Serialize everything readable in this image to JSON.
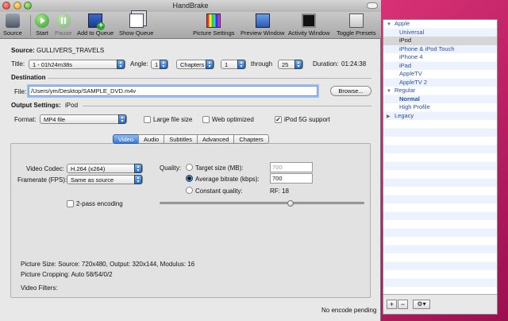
{
  "window": {
    "title": "HandBrake"
  },
  "toolbar": {
    "source": "Source",
    "start": "Start",
    "pause": "Pause",
    "add_to_queue": "Add to Queue",
    "show_queue": "Show Queue",
    "picture_settings": "Picture Settings",
    "preview_window": "Preview Window",
    "activity_window": "Activity Window",
    "toggle_presets": "Toggle Presets"
  },
  "source": {
    "label": "Source:",
    "value": "GULLIVERS_TRAVELS"
  },
  "title_row": {
    "title_label": "Title:",
    "title_value": "1 - 01h24m38s",
    "angle_label": "Angle:",
    "angle_value": "1",
    "range_type": "Chapters",
    "range_start": "1",
    "through_label": "through",
    "range_end": "25",
    "duration_label": "Duration:",
    "duration_value": "01:24:38"
  },
  "destination": {
    "heading": "Destination",
    "file_label": "File:",
    "file_value": "/Users/ym/Desktop/SAMPLE_DVD.m4v",
    "browse": "Browse..."
  },
  "output": {
    "heading_label": "Output Settings:",
    "heading_value": "iPod",
    "format_label": "Format:",
    "format_value": "MP4 file",
    "large_file": "Large file size",
    "web_optimized": "Web optimized",
    "ipod_5g": "iPod 5G support",
    "large_file_checked": false,
    "web_optimized_checked": false,
    "ipod_5g_checked": true
  },
  "tabs": [
    "Video",
    "Audio",
    "Subtitles",
    "Advanced",
    "Chapters"
  ],
  "video": {
    "codec_label": "Video Codec:",
    "codec_value": "H.264 (x264)",
    "framerate_label": "Framerate (FPS):",
    "framerate_value": "Same as source",
    "two_pass": "2-pass encoding",
    "quality_label": "Quality:",
    "target_size_label": "Target size (MB):",
    "target_size_value": "700",
    "avg_bitrate_label": "Average bitrate (kbps):",
    "avg_bitrate_value": "700",
    "constant_quality_label": "Constant quality:",
    "rf_label": "RF: 18",
    "slider_fraction": 0.64
  },
  "picture": {
    "size": "Picture Size: Source: 720x480, Output: 320x144, Modulus: 16",
    "cropping": "Picture Cropping: Auto 58/54/0/2",
    "filters": "Video Filters:"
  },
  "status": "No encode pending",
  "presets": {
    "groups": [
      {
        "name": "Apple",
        "expanded": true,
        "items": [
          "Universal",
          "iPod",
          "iPhone & iPod Touch",
          "iPhone 4",
          "iPad",
          "AppleTV",
          "AppleTV 2"
        ]
      },
      {
        "name": "Regular",
        "expanded": true,
        "items": [
          "Normal",
          "High Profile"
        ]
      },
      {
        "name": "Legacy",
        "expanded": false,
        "items": []
      }
    ],
    "selected": "iPod",
    "default": "Normal",
    "add": "+",
    "remove": "−",
    "gear": "⚙▾"
  }
}
